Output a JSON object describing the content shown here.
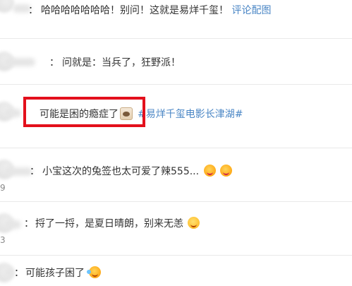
{
  "comments": [
    {
      "text": "哈哈哈哈哈哈哈！别问！这就是易烊千玺！",
      "link": "评论配图",
      "count": ""
    },
    {
      "text": "问就是：当兵了，狂野派！",
      "count": ""
    },
    {
      "text": "可能是困的瘾症了",
      "hashtag": "#易烊千玺电影长津湖#",
      "count": ""
    },
    {
      "text": "小宝这次的兔签也太可爱了辣555...",
      "count": "9"
    },
    {
      "text": "捋了一捋，是夏日晴朗，别来无恙",
      "count": "3"
    },
    {
      "text": "可能孩子困了",
      "count": ""
    }
  ],
  "colon": "：",
  "icons": {
    "emoji_kiss": "kiss-emoji-icon",
    "emoji_shy": "shy-smile-emoji-icon",
    "emoji_laugh": "laugh-tears-emoji-icon",
    "cat": "cat-sticker-icon"
  },
  "colors": {
    "link": "#4a86c5",
    "highlight": "#e3101c",
    "divider": "#e9e9e9"
  }
}
